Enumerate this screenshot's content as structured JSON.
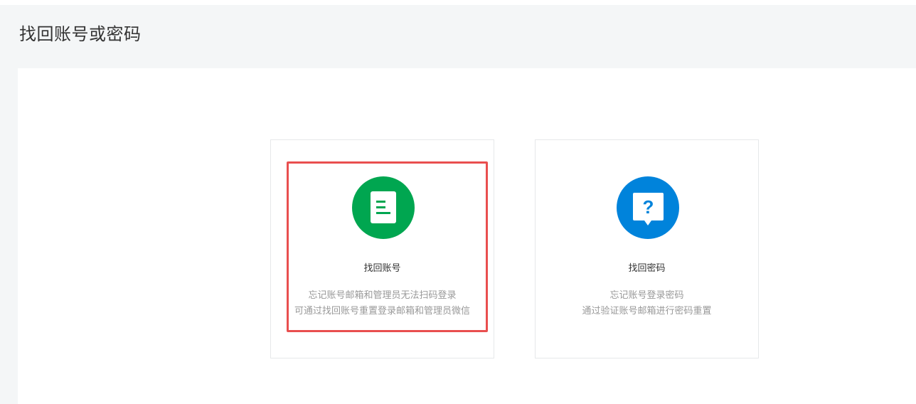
{
  "page": {
    "title": "找回账号或密码"
  },
  "cards": [
    {
      "title": "找回账号",
      "desc_line1": "忘记账号邮箱和管理员无法扫码登录",
      "desc_line2": "可通过找回账号重置登录邮箱和管理员微信",
      "icon": "document-icon",
      "icon_color": "#00a650"
    },
    {
      "title": "找回密码",
      "desc_line1": "忘记账号登录密码",
      "desc_line2": "通过验证账号邮箱进行密码重置",
      "icon": "question-bubble-icon",
      "icon_color": "#0083db"
    }
  ],
  "highlight_color": "#e94f4f"
}
